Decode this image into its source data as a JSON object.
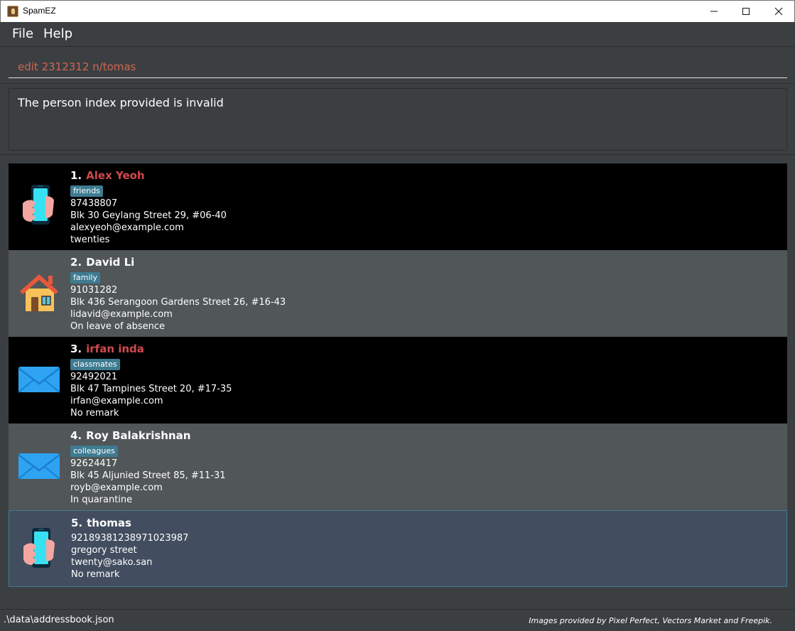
{
  "window": {
    "title": "SpamEZ",
    "minimize_label": "—",
    "maximize_label": "☐",
    "close_label": "✕"
  },
  "menu": {
    "file": "File",
    "help": "Help"
  },
  "command": {
    "value": "edit 2312312 n/tomas"
  },
  "result": {
    "message": "The person index provided is invalid"
  },
  "persons": [
    {
      "index": "1.",
      "name": "Alex Yeoh",
      "tag": "friends",
      "phone": "87438807",
      "address": "Blk 30 Geylang Street 29, #06-40",
      "email": "alexyeoh@example.com",
      "remark": "twenties",
      "icon": "phone-hand-icon",
      "name_color": "#d2484e"
    },
    {
      "index": "2.",
      "name": "David Li",
      "tag": "family",
      "phone": "91031282",
      "address": "Blk 436 Serangoon Gardens Street 26, #16-43",
      "email": "lidavid@example.com",
      "remark": "On leave of absence",
      "icon": "house-icon",
      "name_color": "#ffffff"
    },
    {
      "index": "3.",
      "name": "irfan inda",
      "tag": "classmates",
      "phone": "92492021",
      "address": "Blk 47 Tampines Street 20, #17-35",
      "email": "irfan@example.com",
      "remark": "No remark",
      "icon": "envelope-icon",
      "name_color": "#d2484e"
    },
    {
      "index": "4.",
      "name": "Roy Balakrishnan",
      "tag": "colleagues",
      "phone": "92624417",
      "address": "Blk 45 Aljunied Street 85, #11-31",
      "email": "royb@example.com",
      "remark": "In quarantine",
      "icon": "envelope-icon",
      "name_color": "#ffffff"
    },
    {
      "index": "5.",
      "name": "thomas",
      "tag": "",
      "phone": "92189381238971023987",
      "address": "gregory street",
      "email": "twenty@sako.san",
      "remark": "No remark",
      "icon": "phone-hand-icon",
      "name_color": "#ffffff"
    }
  ],
  "status": {
    "file_path": ".\\data\\addressbook.json",
    "credits": "Images provided by Pixel Perfect, Vectors Market and Freepik."
  }
}
